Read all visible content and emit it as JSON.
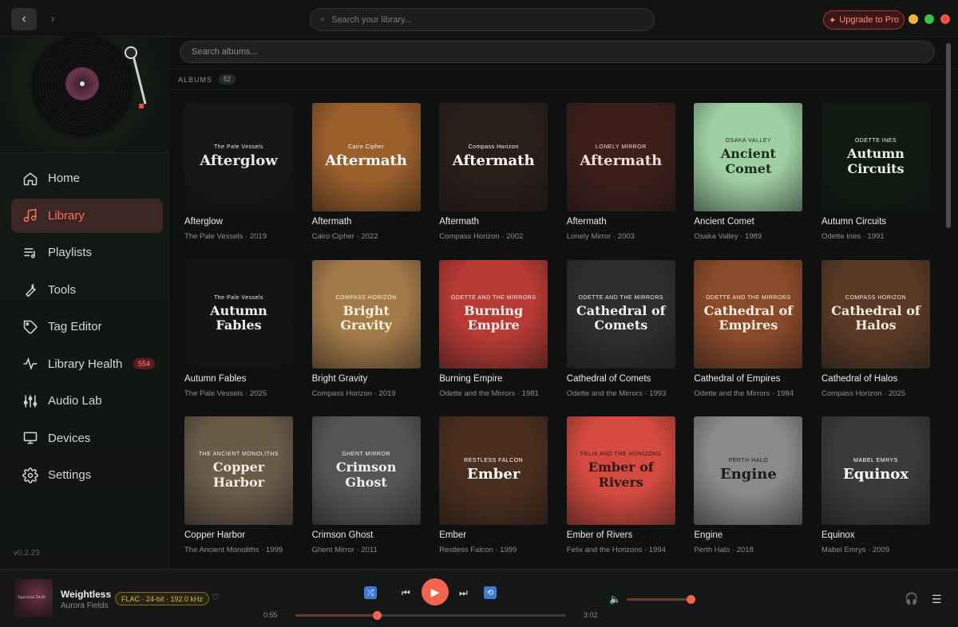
{
  "topbar": {
    "search_placeholder": "Search your library...",
    "upgrade_label": "Upgrade to Pro",
    "back_icon": "chevron-left-icon",
    "forward_icon": "chevron-right-icon"
  },
  "sidebar": {
    "items": [
      {
        "label": "Home",
        "icon": "home-icon"
      },
      {
        "label": "Library",
        "icon": "music-note-icon",
        "active": true
      },
      {
        "label": "Playlists",
        "icon": "playlist-icon"
      },
      {
        "label": "Tools",
        "icon": "wrench-icon"
      },
      {
        "label": "Tag Editor",
        "icon": "tag-icon"
      },
      {
        "label": "Library Health",
        "icon": "pulse-icon",
        "badge": "554"
      },
      {
        "label": "Audio Lab",
        "icon": "sliders-icon"
      },
      {
        "label": "Devices",
        "icon": "monitor-icon"
      },
      {
        "label": "Settings",
        "icon": "gear-icon"
      }
    ],
    "version": "v0.2.23"
  },
  "main": {
    "search_placeholder": "Search albums...",
    "section_label": "ALBUMS",
    "section_count": "52"
  },
  "albums": [
    {
      "title": "Afterglow",
      "sub": "The Pale Vessels · 2019"
    },
    {
      "title": "Aftermath",
      "sub": "Cairo Cipher · 2022"
    },
    {
      "title": "Aftermath",
      "sub": "Compass Horizon · 2002"
    },
    {
      "title": "Aftermath",
      "sub": "Lonely Mirror · 2003"
    },
    {
      "title": "Ancient Comet",
      "sub": "Osaka Valley · 1989"
    },
    {
      "title": "Autumn Circuits",
      "sub": "Odette Ines · 1991"
    },
    {
      "title": "Autumn Fables",
      "sub": "The Pale Vessels · 2025"
    },
    {
      "title": "Bright Gravity",
      "sub": "Compass Horizon · 2019"
    },
    {
      "title": "Burning Empire",
      "sub": "Odette and the Mirrors · 1981"
    },
    {
      "title": "Cathedral of Comets",
      "sub": "Odette and the Mirrors · 1993"
    },
    {
      "title": "Cathedral of Empires",
      "sub": "Odette and the Mirrors · 1984"
    },
    {
      "title": "Cathedral of Halos",
      "sub": "Compass Horizon · 2025"
    },
    {
      "title": "Copper Harbor",
      "sub": "The Ancient Monoliths · 1999"
    },
    {
      "title": "Crimson Ghost",
      "sub": "Ghent Mirror · 2011"
    },
    {
      "title": "Ember",
      "sub": "Restless Falcon · 1999"
    },
    {
      "title": "Ember of Rivers",
      "sub": "Felix and the Horizons · 1994"
    },
    {
      "title": "Engine",
      "sub": "Perth Halo · 2018"
    },
    {
      "title": "Equinox",
      "sub": "Mabel Emrys · 2009"
    }
  ],
  "covers": [
    {
      "small": "The Pale Vessels",
      "big": "Afterglow",
      "bg": "#161616",
      "fg": "#e8e8e8"
    },
    {
      "small": "Cairo Cipher",
      "big": "Aftermath",
      "bg": "#9b5f2c",
      "fg": "#ffffff"
    },
    {
      "small": "Compass Horizon",
      "big": "Aftermath",
      "bg": "#2a1e1a",
      "fg": "#ffffff"
    },
    {
      "small": "LONELY MIRROR",
      "big": "Aftermath",
      "bg": "#3d1f1a",
      "fg": "#f0e0d6"
    },
    {
      "small": "OSAKA VALLEY",
      "big": "Ancient Comet",
      "bg": "#9fd0a4",
      "fg": "#1e2a20"
    },
    {
      "small": "ODETTE INES",
      "big": "Autumn Circuits",
      "bg": "#0f1a12",
      "fg": "#f0f0f0"
    },
    {
      "small": "The Pale Vessels",
      "big": "Autumn Fables",
      "bg": "#141414",
      "fg": "#f0f0f0"
    },
    {
      "small": "COMPASS HORIZON",
      "big": "Bright Gravity",
      "bg": "#a37a4a",
      "fg": "#fff4e0"
    },
    {
      "small": "ODETTE AND THE MIRRORS",
      "big": "Burning Empire",
      "bg": "#b83a35",
      "fg": "#fff0e8"
    },
    {
      "small": "ODETTE AND THE MIRRORS",
      "big": "Cathedral of Comets",
      "bg": "#2e2e2e",
      "fg": "#f0f0f0"
    },
    {
      "small": "ODETTE AND THE MIRRORS",
      "big": "Cathedral of Empires",
      "bg": "#8a4a2a",
      "fg": "#fff0e0"
    },
    {
      "small": "COMPASS HORIZON",
      "big": "Cathedral of Halos",
      "bg": "#5a3a26",
      "fg": "#f5ece0"
    },
    {
      "small": "THE ANCIENT MONOLITHS",
      "big": "Copper Harbor",
      "bg": "#6a5a48",
      "fg": "#f2ece4"
    },
    {
      "small": "GHENT MIRROR",
      "big": "Crimson Ghost",
      "bg": "#555555",
      "fg": "#f0f0f0"
    },
    {
      "small": "RESTLESS FALCON",
      "big": "Ember",
      "bg": "#4a2e1e",
      "fg": "#ffffff"
    },
    {
      "small": "FELIX AND THE HORIZONS",
      "big": "Ember of Rivers",
      "bg": "#d44a40",
      "fg": "#2a1a14"
    },
    {
      "small": "PERTH HALO",
      "big": "Engine",
      "bg": "#8a8a8a",
      "fg": "#1a1a1a"
    },
    {
      "small": "MABEL EMRYS",
      "big": "Equinox",
      "bg": "#3a3a3a",
      "fg": "#ffffff"
    }
  ],
  "player": {
    "art_text": "Spectral Drift",
    "title": "Weightless",
    "artist": "Aurora Fields",
    "format": "FLAC · 24-bit · 192.0 kHz",
    "elapsed": "0:55",
    "duration": "3:02",
    "progress": 0.3,
    "volume": 1.0
  },
  "colors": {
    "accent": "#f26450",
    "active_nav_bg": "#3a2622",
    "format_badge": "#e0b64a"
  }
}
